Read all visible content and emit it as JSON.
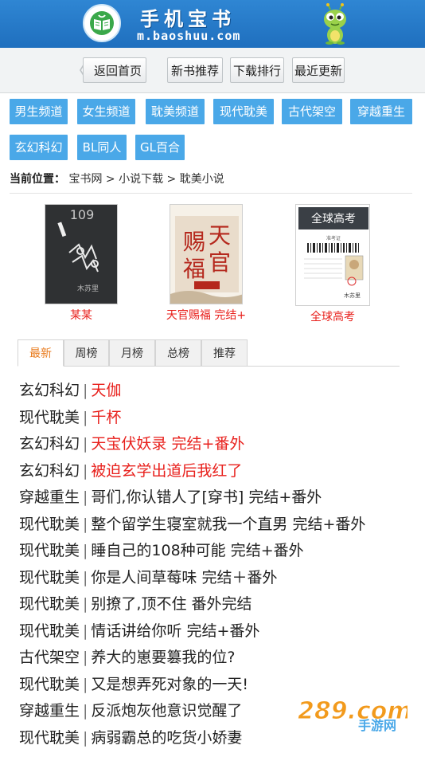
{
  "header": {
    "title": "手机宝书",
    "url": "m.baoshuu.com"
  },
  "nav": {
    "back": "返回首页",
    "buttons": [
      "新书推荐",
      "下载排行",
      "最近更新"
    ]
  },
  "categories": [
    "男生频道",
    "女生频道",
    "耽美频道",
    "现代耽美",
    "古代架空",
    "穿越重生",
    "玄幻科幻",
    "BL同人",
    "GL百合"
  ],
  "breadcrumb": {
    "label": "当前位置：",
    "path": "宝书网 > 小说下载 > 耽美小说"
  },
  "books": [
    {
      "title": "某某"
    },
    {
      "title": "天官赐福 完结+",
      "cover_text": "天官赐福"
    },
    {
      "title": "全球高考",
      "cover_text": "全球高考"
    }
  ],
  "tabs": [
    "最新",
    "周榜",
    "月榜",
    "总榜",
    "推荐"
  ],
  "list": [
    {
      "cat": "玄幻科幻",
      "title": "天伽",
      "red": true
    },
    {
      "cat": "现代耽美",
      "title": "千杯",
      "red": true
    },
    {
      "cat": "玄幻科幻",
      "title": "天宝伏妖录 完结+番外",
      "red": true
    },
    {
      "cat": "玄幻科幻",
      "title": "被迫玄学出道后我红了",
      "red": true
    },
    {
      "cat": "穿越重生",
      "title": "哥们,你认错人了[穿书] 完结+番外",
      "red": false
    },
    {
      "cat": "现代耽美",
      "title": "整个留学生寝室就我一个直男 完结+番外",
      "red": false
    },
    {
      "cat": "现代耽美",
      "title": "睡自己的108种可能 完结+番外",
      "red": false
    },
    {
      "cat": "现代耽美",
      "title": "你是人间草莓味 完结＋番外",
      "red": false
    },
    {
      "cat": "现代耽美",
      "title": "别撩了,顶不住 番外完结",
      "red": false
    },
    {
      "cat": "现代耽美",
      "title": "情话讲给你听 完结+番外",
      "red": false
    },
    {
      "cat": "古代架空",
      "title": "养大的崽要篡我的位?",
      "red": false
    },
    {
      "cat": "现代耽美",
      "title": "又是想弄死对象的一天!",
      "red": false
    },
    {
      "cat": "穿越重生",
      "title": "反派炮灰他意识觉醒了",
      "red": false
    },
    {
      "cat": "现代耽美",
      "title": "病弱霸总的吃货小娇妻",
      "red": false
    }
  ],
  "watermark": {
    "brand": "289.com",
    "sub": "手游网"
  },
  "colors": {
    "header": "#1f6fbe",
    "tag": "#4aa8e8",
    "red": "#e8201c",
    "tab_active": "#e87a1c"
  }
}
